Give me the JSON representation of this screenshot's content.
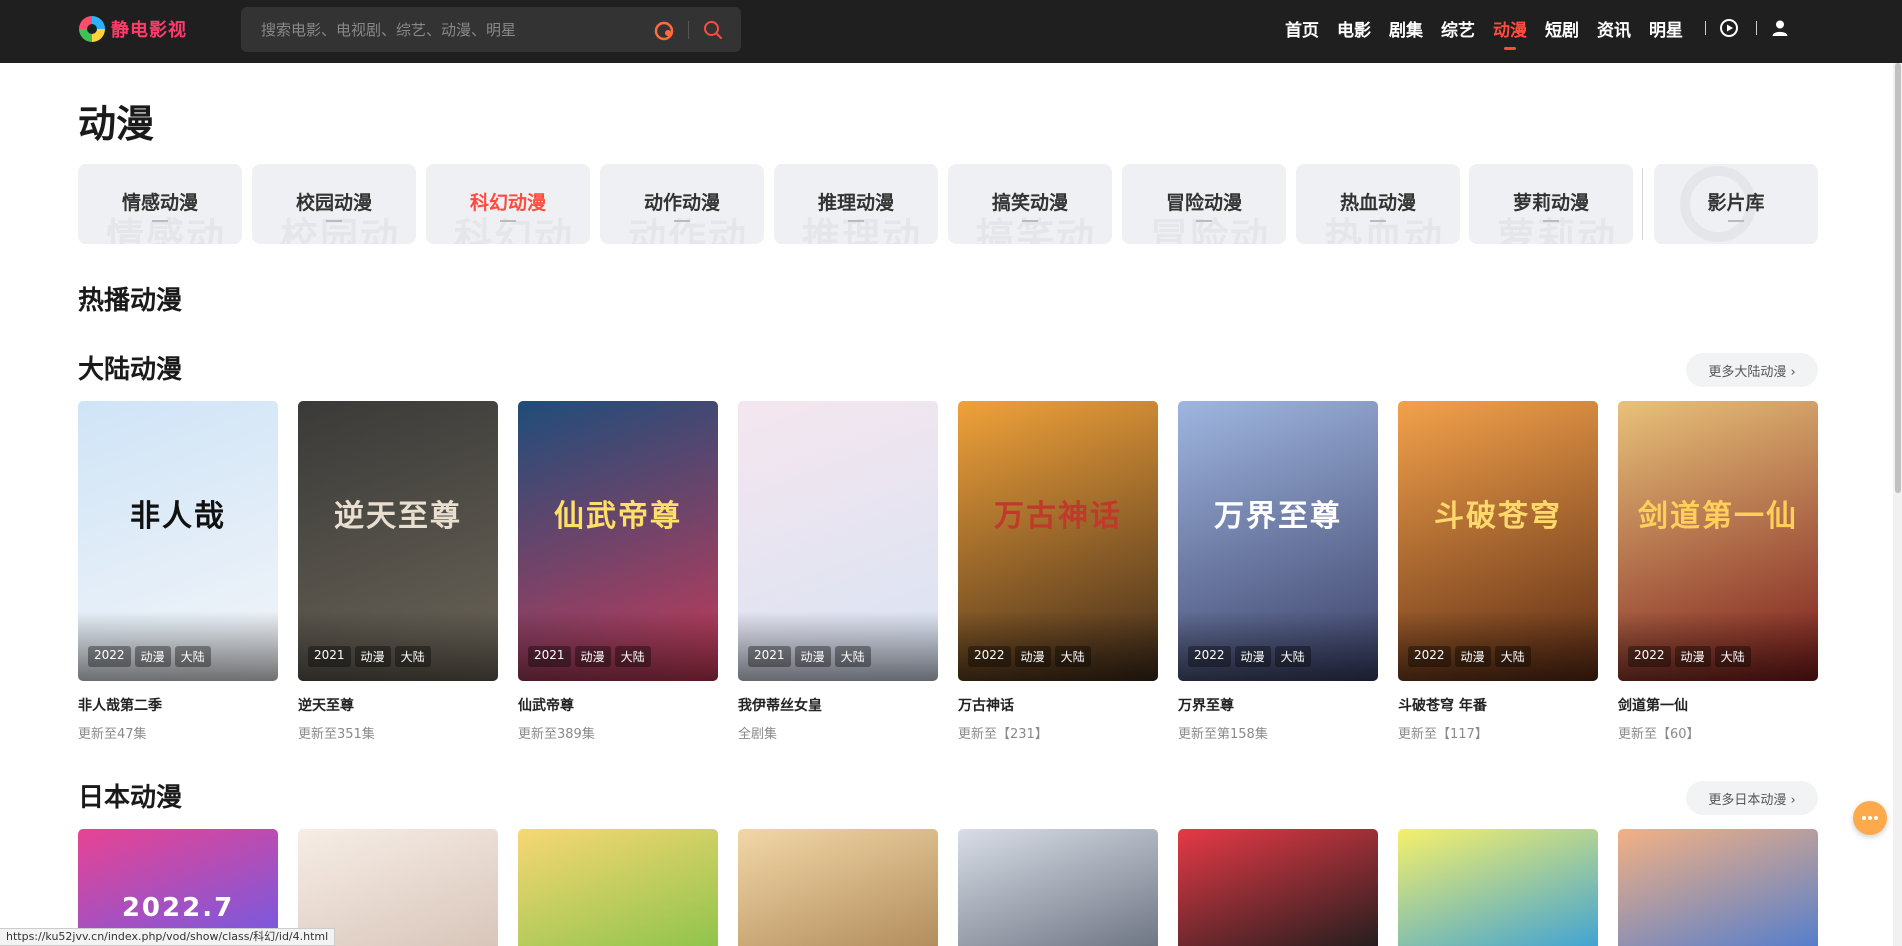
{
  "header": {
    "logo_text": "静电影视",
    "search_placeholder": "搜索电影、电视剧、综艺、动漫、明星",
    "nav": [
      "首页",
      "电影",
      "剧集",
      "综艺",
      "动漫",
      "短剧",
      "资讯",
      "明星"
    ],
    "active_nav": "动漫",
    "icons": [
      "hot-fire-icon",
      "search-icon",
      "play-history-icon",
      "user-icon"
    ]
  },
  "page_title": "动漫",
  "categories": [
    {
      "label": "情感动漫",
      "bg": "情感动"
    },
    {
      "label": "校园动漫",
      "bg": "校园动"
    },
    {
      "label": "科幻动漫",
      "bg": "科幻动",
      "active": true
    },
    {
      "label": "动作动漫",
      "bg": "动作动"
    },
    {
      "label": "推理动漫",
      "bg": "推理动"
    },
    {
      "label": "搞笑动漫",
      "bg": "搞笑动"
    },
    {
      "label": "冒险动漫",
      "bg": "冒险动"
    },
    {
      "label": "热血动漫",
      "bg": "热血动"
    },
    {
      "label": "萝莉动漫",
      "bg": "萝莉动"
    }
  ],
  "library_label": "影片库",
  "sections": {
    "hot_title": "热播动漫",
    "mainland": {
      "title": "大陆动漫",
      "more": "更多大陆动漫 ›",
      "items": [
        {
          "name": "非人哉第二季",
          "sub": "更新至47集",
          "tags": [
            "2022",
            "动漫",
            "大陆"
          ],
          "poster_text": "非人哉",
          "c1": "#cfe4f7",
          "c2": "#f3f5f8",
          "fg": "#111"
        },
        {
          "name": "逆天至尊",
          "sub": "更新至351集",
          "tags": [
            "2021",
            "动漫",
            "大陆"
          ],
          "poster_text": "逆天至尊",
          "c1": "#3a3a38",
          "c2": "#6b6458",
          "fg": "#e8dfd0"
        },
        {
          "name": "仙武帝尊",
          "sub": "更新至389集",
          "tags": [
            "2021",
            "动漫",
            "大陆"
          ],
          "poster_text": "仙武帝尊",
          "c1": "#1f4d7a",
          "c2": "#c73a58",
          "fg": "#ffe066"
        },
        {
          "name": "我伊蒂丝女皇",
          "sub": "全剧集",
          "tags": [
            "2021",
            "动漫",
            "大陆"
          ],
          "poster_text": "",
          "c1": "#f4e6ef",
          "c2": "#d9e3f3",
          "fg": "#7a4d6b"
        },
        {
          "name": "万古神话",
          "sub": "更新至【231】",
          "tags": [
            "2022",
            "动漫",
            "大陆"
          ],
          "poster_text": "万古神话",
          "c1": "#f0a23a",
          "c2": "#3e2a1a",
          "fg": "#c0392b"
        },
        {
          "name": "万界至尊",
          "sub": "更新至第158集",
          "tags": [
            "2022",
            "动漫",
            "大陆"
          ],
          "poster_text": "万界至尊",
          "c1": "#9fb6e0",
          "c2": "#3a3f66",
          "fg": "#ffffff"
        },
        {
          "name": "斗破苍穹 年番",
          "sub": "更新至【117】",
          "tags": [
            "2022",
            "动漫",
            "大陆"
          ],
          "poster_text": "斗破苍穹",
          "c1": "#f3a24b",
          "c2": "#5a2a14",
          "fg": "#ffd86b"
        },
        {
          "name": "剑道第一仙",
          "sub": "更新至【60】",
          "tags": [
            "2022",
            "动漫",
            "大陆"
          ],
          "poster_text": "剑道第一仙",
          "c1": "#e8c27a",
          "c2": "#7a1b1b",
          "fg": "#ffcf5a"
        }
      ]
    },
    "japan": {
      "title": "日本动漫",
      "more": "更多日本动漫 ›",
      "items": [
        {
          "poster_text": "2022.7",
          "c1": "#e84393",
          "c2": "#6c5ce7",
          "fg": "#ffffff"
        },
        {
          "poster_text": "",
          "c1": "#f6ede6",
          "c2": "#d7c4b8",
          "fg": "#333"
        },
        {
          "poster_text": "",
          "c1": "#f7d774",
          "c2": "#8bc34a",
          "fg": "#333"
        },
        {
          "poster_text": "",
          "c1": "#f2d7a6",
          "c2": "#b08a5a",
          "fg": "#333"
        },
        {
          "poster_text": "",
          "c1": "#d8dde6",
          "c2": "#6b7280",
          "fg": "#333"
        },
        {
          "poster_text": "",
          "c1": "#e63946",
          "c2": "#1d1d1d",
          "fg": "#fff"
        },
        {
          "poster_text": "",
          "c1": "#f6f06b",
          "c2": "#3aa0d8",
          "fg": "#333"
        },
        {
          "poster_text": "",
          "c1": "#f4b183",
          "c2": "#4f7ccf",
          "fg": "#333"
        }
      ]
    }
  },
  "status_url": "https://ku52jvv.cn/index.php/vod/show/class/科幻/id/4.html",
  "colors": {
    "accent": "#ff4b3e",
    "header_bg": "#1f1f1f"
  }
}
